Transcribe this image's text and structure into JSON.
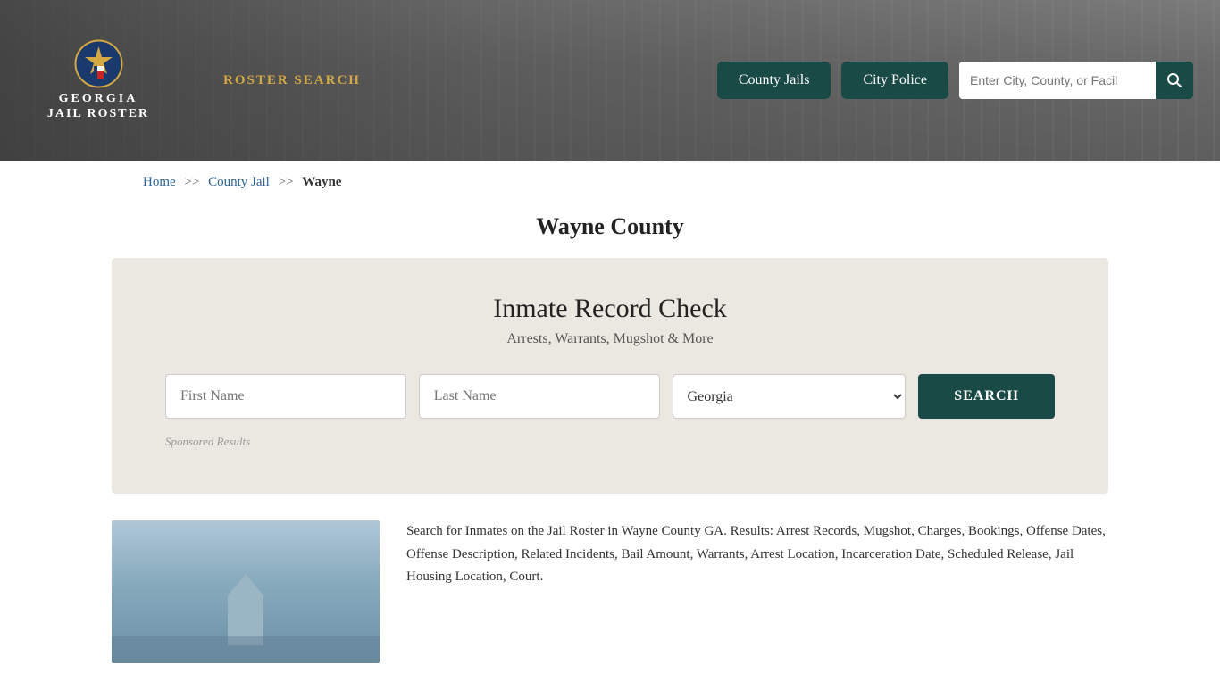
{
  "header": {
    "logo_title": "GEORGIA",
    "logo_subtitle": "JAIL ROSTER",
    "nav_roster": "ROSTER SEARCH",
    "btn_county_jails": "County Jails",
    "btn_city_police": "City Police",
    "search_placeholder": "Enter City, County, or Facil"
  },
  "breadcrumb": {
    "home": "Home",
    "sep1": ">>",
    "county_jail": "County Jail",
    "sep2": ">>",
    "current": "Wayne"
  },
  "page": {
    "title": "Wayne County"
  },
  "record_check": {
    "title": "Inmate Record Check",
    "subtitle": "Arrests, Warrants, Mugshot & More",
    "first_name_placeholder": "First Name",
    "last_name_placeholder": "Last Name",
    "state_default": "Georgia",
    "search_btn": "SEARCH",
    "sponsored": "Sponsored Results"
  },
  "bottom": {
    "description": "Search for Inmates on the Jail Roster in Wayne County GA. Results: Arrest Records, Mugshot, Charges, Bookings, Offense Dates, Offense Description, Related Incidents, Bail Amount, Warrants, Arrest Location, Incarceration Date, Scheduled Release, Jail Housing Location, Court."
  }
}
